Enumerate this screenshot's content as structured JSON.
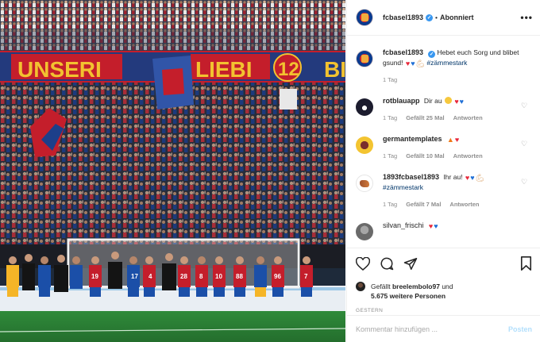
{
  "post": {
    "username": "fcbasel1893",
    "follow_state": "Abonniert",
    "more_icon": "more-horizontal-icon"
  },
  "photo": {
    "banner_left": "UNSERI",
    "banner_mid": "LIEBI",
    "banner_num": "12",
    "banner_right": "BI",
    "jersey_numbers": [
      "19",
      "4",
      "28",
      "8",
      "10",
      "17",
      "88",
      "96",
      "7"
    ]
  },
  "caption": {
    "username": "fcbasel1893",
    "text": "Hebet euch Sorg und blibet gsund!",
    "hashtag": "#zämmestark",
    "time": "1 Tag"
  },
  "comments": [
    {
      "username": "rotblauapp",
      "text": "Dir au",
      "time": "1 Tag",
      "likes": "Gefällt 25 Mal",
      "reply": "Antworten"
    },
    {
      "username": "germantemplates",
      "text": "",
      "time": "1 Tag",
      "likes": "Gefällt 10 Mal",
      "reply": "Antworten"
    },
    {
      "username": "1893fcbasel1893",
      "text": "Ihr au!",
      "hashtag": "#zämmestark",
      "time": "1 Tag",
      "likes": "Gefällt 7 Mal",
      "reply": "Antworten"
    },
    {
      "username": "silvan_frischi",
      "text": ""
    }
  ],
  "likes": {
    "prefix": "Gefällt",
    "user": "breelembolo97",
    "joiner": "und",
    "others": "5.675 weitere Personen"
  },
  "posted": "GESTERN",
  "comment_box": {
    "placeholder": "Kommentar hinzufügen ...",
    "post_label": "Posten"
  },
  "colors": {
    "accent_blue": "#3897f0",
    "post_disabled": "#b2dffc",
    "fcb_red": "#d41f2d",
    "fcb_blue": "#0a3b8f"
  }
}
